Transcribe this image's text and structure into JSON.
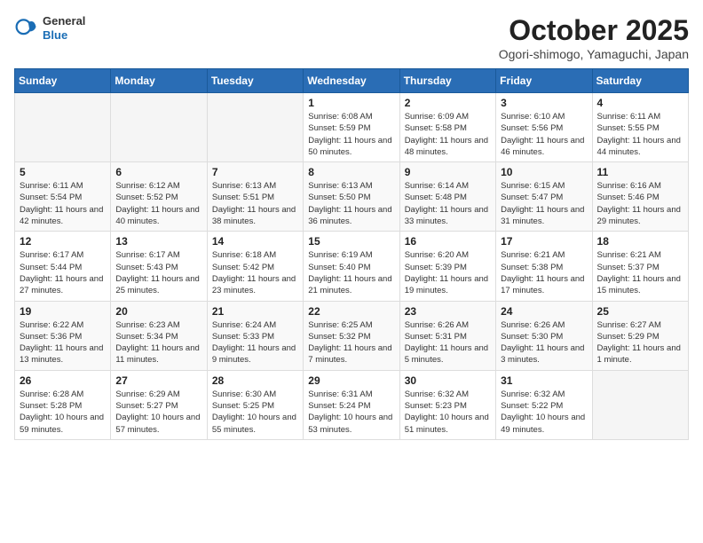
{
  "header": {
    "logo_general": "General",
    "logo_blue": "Blue",
    "month_title": "October 2025",
    "location": "Ogori-shimogo, Yamaguchi, Japan"
  },
  "weekdays": [
    "Sunday",
    "Monday",
    "Tuesday",
    "Wednesday",
    "Thursday",
    "Friday",
    "Saturday"
  ],
  "weeks": [
    [
      {
        "day": "",
        "sunrise": "",
        "sunset": "",
        "daylight": ""
      },
      {
        "day": "",
        "sunrise": "",
        "sunset": "",
        "daylight": ""
      },
      {
        "day": "",
        "sunrise": "",
        "sunset": "",
        "daylight": ""
      },
      {
        "day": "1",
        "sunrise": "Sunrise: 6:08 AM",
        "sunset": "Sunset: 5:59 PM",
        "daylight": "Daylight: 11 hours and 50 minutes."
      },
      {
        "day": "2",
        "sunrise": "Sunrise: 6:09 AM",
        "sunset": "Sunset: 5:58 PM",
        "daylight": "Daylight: 11 hours and 48 minutes."
      },
      {
        "day": "3",
        "sunrise": "Sunrise: 6:10 AM",
        "sunset": "Sunset: 5:56 PM",
        "daylight": "Daylight: 11 hours and 46 minutes."
      },
      {
        "day": "4",
        "sunrise": "Sunrise: 6:11 AM",
        "sunset": "Sunset: 5:55 PM",
        "daylight": "Daylight: 11 hours and 44 minutes."
      }
    ],
    [
      {
        "day": "5",
        "sunrise": "Sunrise: 6:11 AM",
        "sunset": "Sunset: 5:54 PM",
        "daylight": "Daylight: 11 hours and 42 minutes."
      },
      {
        "day": "6",
        "sunrise": "Sunrise: 6:12 AM",
        "sunset": "Sunset: 5:52 PM",
        "daylight": "Daylight: 11 hours and 40 minutes."
      },
      {
        "day": "7",
        "sunrise": "Sunrise: 6:13 AM",
        "sunset": "Sunset: 5:51 PM",
        "daylight": "Daylight: 11 hours and 38 minutes."
      },
      {
        "day": "8",
        "sunrise": "Sunrise: 6:13 AM",
        "sunset": "Sunset: 5:50 PM",
        "daylight": "Daylight: 11 hours and 36 minutes."
      },
      {
        "day": "9",
        "sunrise": "Sunrise: 6:14 AM",
        "sunset": "Sunset: 5:48 PM",
        "daylight": "Daylight: 11 hours and 33 minutes."
      },
      {
        "day": "10",
        "sunrise": "Sunrise: 6:15 AM",
        "sunset": "Sunset: 5:47 PM",
        "daylight": "Daylight: 11 hours and 31 minutes."
      },
      {
        "day": "11",
        "sunrise": "Sunrise: 6:16 AM",
        "sunset": "Sunset: 5:46 PM",
        "daylight": "Daylight: 11 hours and 29 minutes."
      }
    ],
    [
      {
        "day": "12",
        "sunrise": "Sunrise: 6:17 AM",
        "sunset": "Sunset: 5:44 PM",
        "daylight": "Daylight: 11 hours and 27 minutes."
      },
      {
        "day": "13",
        "sunrise": "Sunrise: 6:17 AM",
        "sunset": "Sunset: 5:43 PM",
        "daylight": "Daylight: 11 hours and 25 minutes."
      },
      {
        "day": "14",
        "sunrise": "Sunrise: 6:18 AM",
        "sunset": "Sunset: 5:42 PM",
        "daylight": "Daylight: 11 hours and 23 minutes."
      },
      {
        "day": "15",
        "sunrise": "Sunrise: 6:19 AM",
        "sunset": "Sunset: 5:40 PM",
        "daylight": "Daylight: 11 hours and 21 minutes."
      },
      {
        "day": "16",
        "sunrise": "Sunrise: 6:20 AM",
        "sunset": "Sunset: 5:39 PM",
        "daylight": "Daylight: 11 hours and 19 minutes."
      },
      {
        "day": "17",
        "sunrise": "Sunrise: 6:21 AM",
        "sunset": "Sunset: 5:38 PM",
        "daylight": "Daylight: 11 hours and 17 minutes."
      },
      {
        "day": "18",
        "sunrise": "Sunrise: 6:21 AM",
        "sunset": "Sunset: 5:37 PM",
        "daylight": "Daylight: 11 hours and 15 minutes."
      }
    ],
    [
      {
        "day": "19",
        "sunrise": "Sunrise: 6:22 AM",
        "sunset": "Sunset: 5:36 PM",
        "daylight": "Daylight: 11 hours and 13 minutes."
      },
      {
        "day": "20",
        "sunrise": "Sunrise: 6:23 AM",
        "sunset": "Sunset: 5:34 PM",
        "daylight": "Daylight: 11 hours and 11 minutes."
      },
      {
        "day": "21",
        "sunrise": "Sunrise: 6:24 AM",
        "sunset": "Sunset: 5:33 PM",
        "daylight": "Daylight: 11 hours and 9 minutes."
      },
      {
        "day": "22",
        "sunrise": "Sunrise: 6:25 AM",
        "sunset": "Sunset: 5:32 PM",
        "daylight": "Daylight: 11 hours and 7 minutes."
      },
      {
        "day": "23",
        "sunrise": "Sunrise: 6:26 AM",
        "sunset": "Sunset: 5:31 PM",
        "daylight": "Daylight: 11 hours and 5 minutes."
      },
      {
        "day": "24",
        "sunrise": "Sunrise: 6:26 AM",
        "sunset": "Sunset: 5:30 PM",
        "daylight": "Daylight: 11 hours and 3 minutes."
      },
      {
        "day": "25",
        "sunrise": "Sunrise: 6:27 AM",
        "sunset": "Sunset: 5:29 PM",
        "daylight": "Daylight: 11 hours and 1 minute."
      }
    ],
    [
      {
        "day": "26",
        "sunrise": "Sunrise: 6:28 AM",
        "sunset": "Sunset: 5:28 PM",
        "daylight": "Daylight: 10 hours and 59 minutes."
      },
      {
        "day": "27",
        "sunrise": "Sunrise: 6:29 AM",
        "sunset": "Sunset: 5:27 PM",
        "daylight": "Daylight: 10 hours and 57 minutes."
      },
      {
        "day": "28",
        "sunrise": "Sunrise: 6:30 AM",
        "sunset": "Sunset: 5:25 PM",
        "daylight": "Daylight: 10 hours and 55 minutes."
      },
      {
        "day": "29",
        "sunrise": "Sunrise: 6:31 AM",
        "sunset": "Sunset: 5:24 PM",
        "daylight": "Daylight: 10 hours and 53 minutes."
      },
      {
        "day": "30",
        "sunrise": "Sunrise: 6:32 AM",
        "sunset": "Sunset: 5:23 PM",
        "daylight": "Daylight: 10 hours and 51 minutes."
      },
      {
        "day": "31",
        "sunrise": "Sunrise: 6:32 AM",
        "sunset": "Sunset: 5:22 PM",
        "daylight": "Daylight: 10 hours and 49 minutes."
      },
      {
        "day": "",
        "sunrise": "",
        "sunset": "",
        "daylight": ""
      }
    ]
  ]
}
